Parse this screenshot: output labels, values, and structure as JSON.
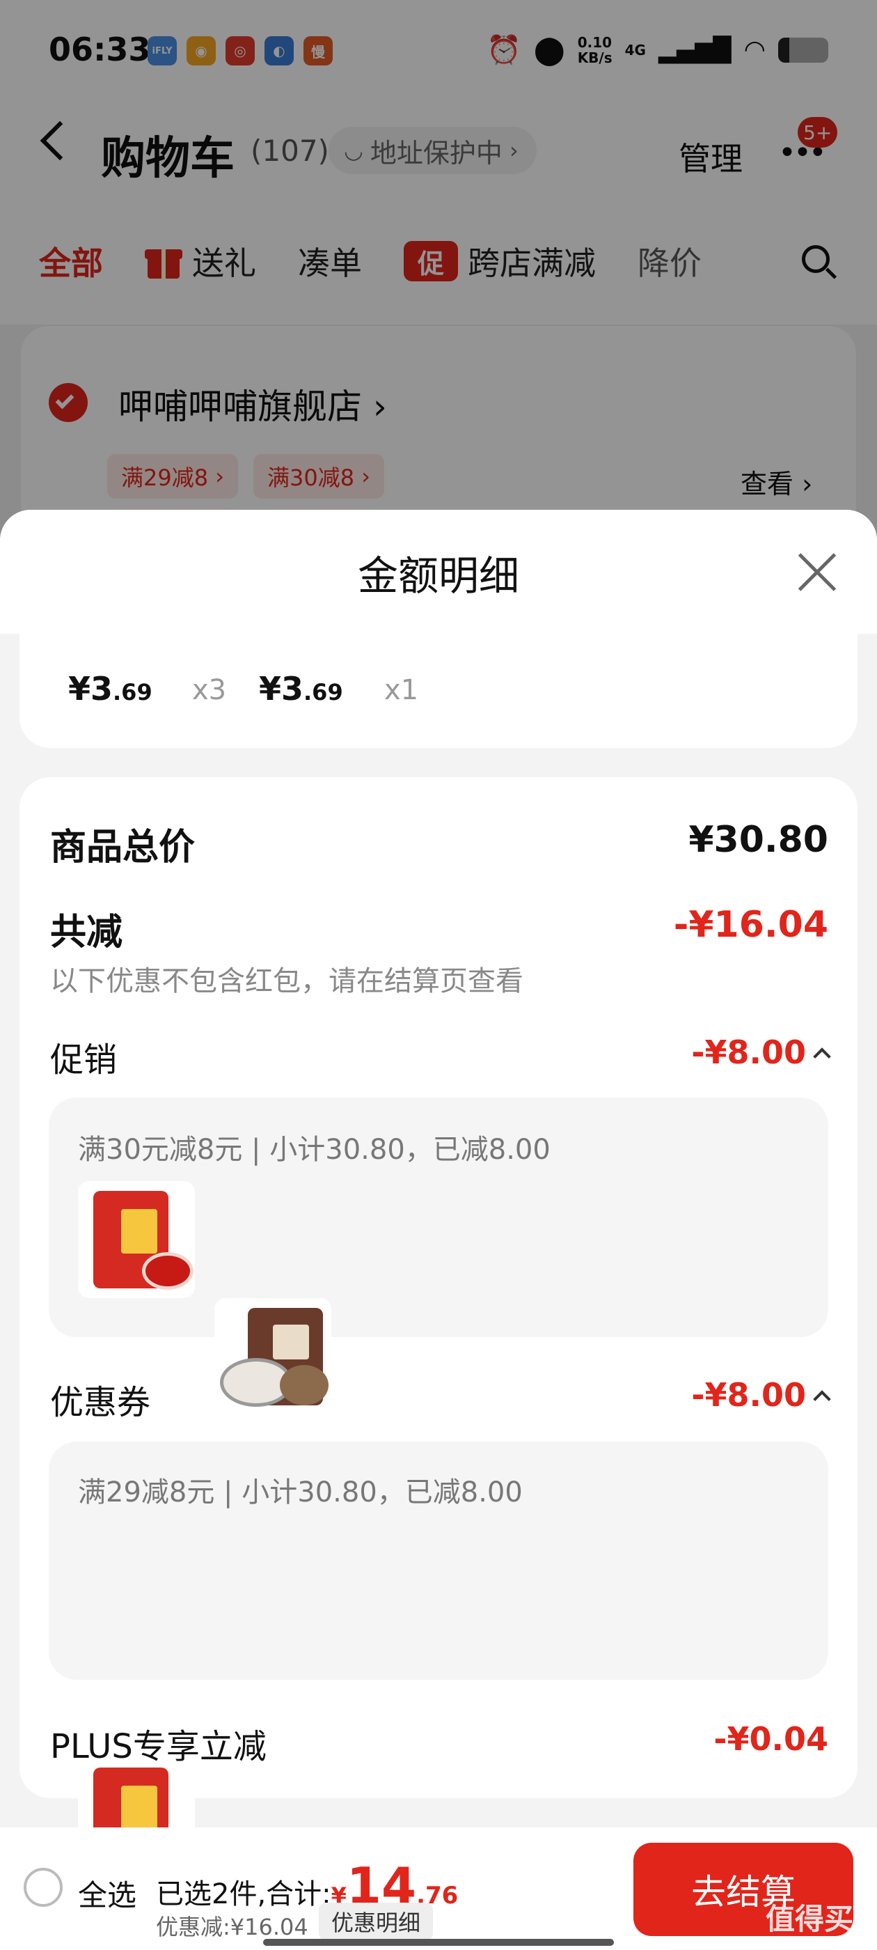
{
  "status_bar": {
    "time": "06:33",
    "network_speed": "0.10\nKB/s",
    "signal": "4G"
  },
  "header": {
    "title": "购物车",
    "count": "(107)",
    "address_protect": "地址保护中",
    "manage": "管理",
    "badge": "5+"
  },
  "tabs": [
    {
      "label": "全部"
    },
    {
      "label": "送礼"
    },
    {
      "label": "凑单"
    },
    {
      "label": "跨店满减",
      "tag": "促"
    },
    {
      "label": "降价"
    }
  ],
  "store": {
    "name": "呷哺呷哺旗舰店",
    "chips": [
      "满29减8",
      "满30减8"
    ],
    "view": "查看"
  },
  "sheet": {
    "title": "金额明细",
    "items": [
      {
        "price_int": "¥3",
        "price_dec": ".69",
        "qty": "x3"
      },
      {
        "price_int": "¥3",
        "price_dec": ".69",
        "qty": "x1"
      }
    ],
    "total_label": "商品总价",
    "total_value": "¥30.80",
    "reduce_label": "共减",
    "reduce_value": "-¥16.04",
    "reduce_note": "以下优惠不包含红包，请在结算页查看",
    "promo_label": "促销",
    "promo_value": "-¥8.00",
    "promo_detail": "满30元减8元 | 小计30.80，已减8.00",
    "coupon_label": "优惠券",
    "coupon_value": "-¥8.00",
    "coupon_detail": "满29减8元 | 小计30.80，已减8.00",
    "plus_label": "PLUS专享立减",
    "plus_value": "-¥0.04"
  },
  "footer": {
    "select_all": "全选",
    "selected": "已选2件,合计:",
    "currency": "¥",
    "total_int": "14",
    "total_dec": ".76",
    "discount": "优惠减:¥16.04",
    "detail_btn": "优惠明细",
    "checkout": "去结算",
    "watermark": "值得买"
  },
  "colors": {
    "accent": "#e1251b"
  }
}
